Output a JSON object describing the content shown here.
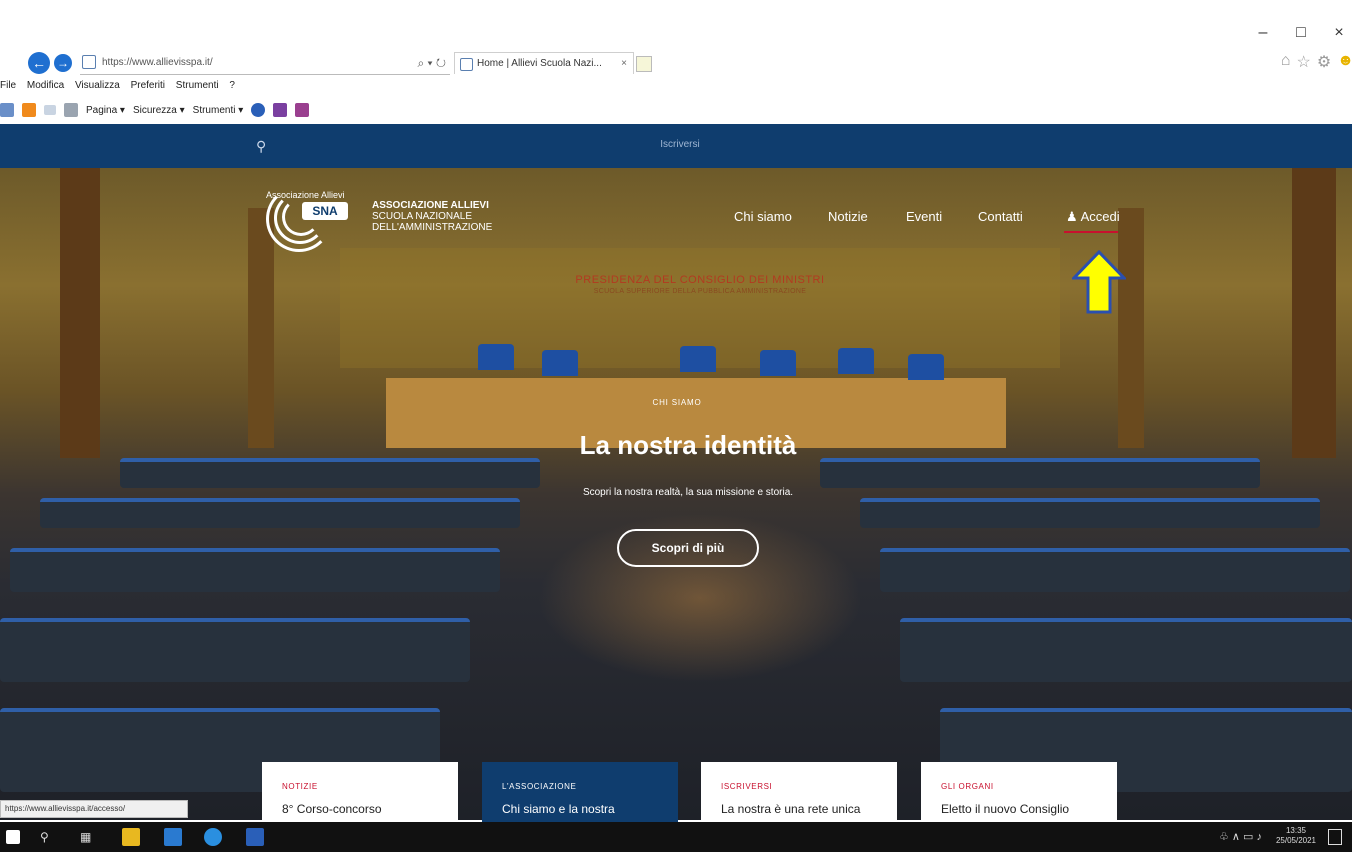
{
  "browser": {
    "url": "https://www.allievisspa.it/",
    "tab_title": "Home | Allievi Scuola Nazi...",
    "tab_close": "×",
    "back_symbol": "←",
    "forward_symbol": "→",
    "search_refresh": "⌕ ▾ ↻",
    "window_controls": {
      "minimize": "–",
      "maximize": "□",
      "close": "×"
    },
    "menu": [
      "File",
      "Modifica",
      "Visualizza",
      "Preferiti",
      "Strumenti",
      "?"
    ],
    "commands": {
      "pagina": "Pagina ▾",
      "sicurezza": "Sicurezza ▾",
      "strumenti": "Strumenti ▾"
    },
    "status_url": "https://www.allievisspa.it/accesso/"
  },
  "site": {
    "topbar": {
      "search_icon": "magnifier-icon",
      "signup": "Iscriversi"
    },
    "logo": {
      "small_text": "Associazione Allievi",
      "badge": "SNA",
      "brand_lines": [
        "ASSOCIAZIONE ALLIEVI",
        "SCUOLA NAZIONALE",
        "DELL'AMMINISTRAZIONE"
      ]
    },
    "nav": [
      "Chi siamo",
      "Notizie",
      "Eventi",
      "Contatti"
    ],
    "login": "Accedi",
    "hero": {
      "sign_line1": "PRESIDENZA DEL CONSIGLIO DEI MINISTRI",
      "sign_line2": "SCUOLA SUPERIORE DELLA PUBBLICA AMMINISTRAZIONE",
      "kicker": "CHI SIAMO",
      "title": "La nostra identità",
      "subtitle": "Scopri la nostra realtà, la sua missione e storia.",
      "cta": "Scopri di più"
    },
    "cards": [
      {
        "label": "NOTIZIE",
        "title": "8° Corso-concorso"
      },
      {
        "label": "L'ASSOCIAZIONE",
        "title": "Chi siamo e la nostra"
      },
      {
        "label": "ISCRIVERSI",
        "title": "La nostra è una rete unica"
      },
      {
        "label": "GLI ORGANI",
        "title": "Eletto il nuovo Consiglio"
      }
    ]
  },
  "taskbar": {
    "time": "13:35",
    "date": "25/05/2021"
  },
  "colors": {
    "navy": "#0f3d6e",
    "accent_red": "#c8102e",
    "arrow_yellow": "#ffff00",
    "arrow_border": "#2a4fb0"
  }
}
